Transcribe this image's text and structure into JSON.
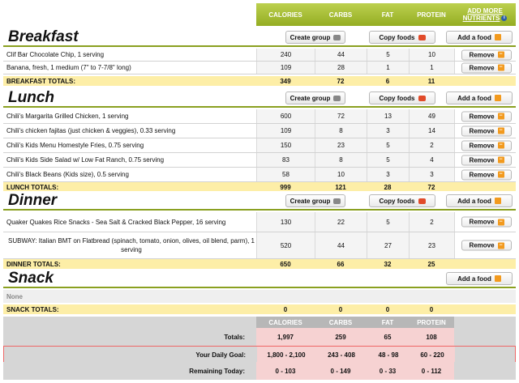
{
  "columns": {
    "calories": "CALORIES",
    "carbs": "CARBS",
    "fat": "FAT",
    "protein": "PROTEIN",
    "add_more": "ADD MORE",
    "nutrients": "NUTRIENTS"
  },
  "buttons": {
    "create_group": "Create group",
    "copy_foods": "Copy foods",
    "add_food": "Add a food",
    "remove": "Remove"
  },
  "meals": {
    "breakfast": {
      "title": "Breakfast",
      "items": [
        {
          "name": "Clif Bar Chocolate Chip, 1 serving",
          "cal": "240",
          "carb": "44",
          "fat": "5",
          "pro": "10"
        },
        {
          "name": "Banana, fresh, 1 medium (7\" to 7-7/8\" long)",
          "cal": "109",
          "carb": "28",
          "fat": "1",
          "pro": "1"
        }
      ],
      "totals": {
        "label": "BREAKFAST TOTALS:",
        "cal": "349",
        "carb": "72",
        "fat": "6",
        "pro": "11"
      }
    },
    "lunch": {
      "title": "Lunch",
      "items": [
        {
          "name": "Chili's Margarita Grilled Chicken, 1 serving",
          "cal": "600",
          "carb": "72",
          "fat": "13",
          "pro": "49"
        },
        {
          "name": "Chili's chicken fajitas (just chicken & veggies), 0.33 serving",
          "cal": "109",
          "carb": "8",
          "fat": "3",
          "pro": "14"
        },
        {
          "name": "Chili's Kids Menu Homestyle Fries, 0.75 serving",
          "cal": "150",
          "carb": "23",
          "fat": "5",
          "pro": "2"
        },
        {
          "name": "Chili's Kids Side Salad w/ Low Fat Ranch, 0.75 serving",
          "cal": "83",
          "carb": "8",
          "fat": "5",
          "pro": "4"
        },
        {
          "name": "Chili's Black Beans (Kids size), 0.5 serving",
          "cal": "58",
          "carb": "10",
          "fat": "3",
          "pro": "3"
        }
      ],
      "totals": {
        "label": "LUNCH TOTALS:",
        "cal": "999",
        "carb": "121",
        "fat": "28",
        "pro": "72"
      }
    },
    "dinner": {
      "title": "Dinner",
      "items": [
        {
          "name": "Quaker Quakes Rice Snacks - Sea Salt & Cracked Black Pepper, 16 serving",
          "cal": "130",
          "carb": "22",
          "fat": "5",
          "pro": "2"
        },
        {
          "name": "SUBWAY: Italian BMT on Flatbread (spinach, tomato, onion, olives, oil blend, parm), 1 serving",
          "cal": "520",
          "carb": "44",
          "fat": "27",
          "pro": "23"
        }
      ],
      "totals": {
        "label": "DINNER TOTALS:",
        "cal": "650",
        "carb": "66",
        "fat": "32",
        "pro": "25"
      }
    },
    "snack": {
      "title": "Snack",
      "none": "None",
      "totals": {
        "label": "SNACK TOTALS:",
        "cal": "0",
        "carb": "0",
        "fat": "0",
        "pro": "0"
      }
    }
  },
  "summary": {
    "headers": {
      "cal": "CALORIES",
      "carb": "CARBS",
      "fat": "FAT",
      "pro": "PROTEIN"
    },
    "totals": {
      "label": "Totals:",
      "cal": "1,997",
      "carb": "259",
      "fat": "65",
      "pro": "108"
    },
    "goal": {
      "label": "Your Daily Goal:",
      "cal": "1,800 - 2,100",
      "carb": "243 - 408",
      "fat": "48 - 98",
      "pro": "60 - 220"
    },
    "remaining": {
      "label": "Remaining Today:",
      "cal": "0 - 103",
      "carb": "0 - 149",
      "fat": "0 - 33",
      "pro": "0 - 112"
    }
  },
  "colors": {
    "header_green": "#a4bb2e",
    "totals_yellow": "#fdeea7",
    "button_orange": "#f29a1e"
  }
}
